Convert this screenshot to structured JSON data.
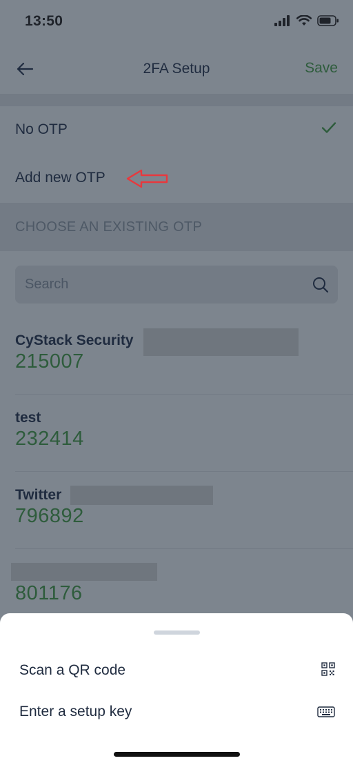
{
  "status_bar": {
    "time": "13:50"
  },
  "nav": {
    "title": "2FA Setup",
    "save_label": "Save"
  },
  "options": [
    {
      "label": "No OTP",
      "selected": true
    },
    {
      "label": "Add new OTP",
      "selected": false
    }
  ],
  "section_header": "CHOOSE AN EXISTING OTP",
  "search": {
    "placeholder": "Search",
    "value": ""
  },
  "otp_items": [
    {
      "name": "CyStack Security",
      "code": "215007"
    },
    {
      "name": "test",
      "code": "232414"
    },
    {
      "name": "Twitter",
      "code": "796892"
    },
    {
      "name": "",
      "code": "801176"
    }
  ],
  "sheet": {
    "items": [
      {
        "label": "Scan a QR code",
        "icon": "qr-code-icon"
      },
      {
        "label": "Enter a setup key",
        "icon": "keyboard-icon"
      }
    ]
  },
  "colors": {
    "accent_green": "#2e5c3c",
    "dimmed_background": "#7d858e",
    "annotation_red": "#e8383d"
  }
}
